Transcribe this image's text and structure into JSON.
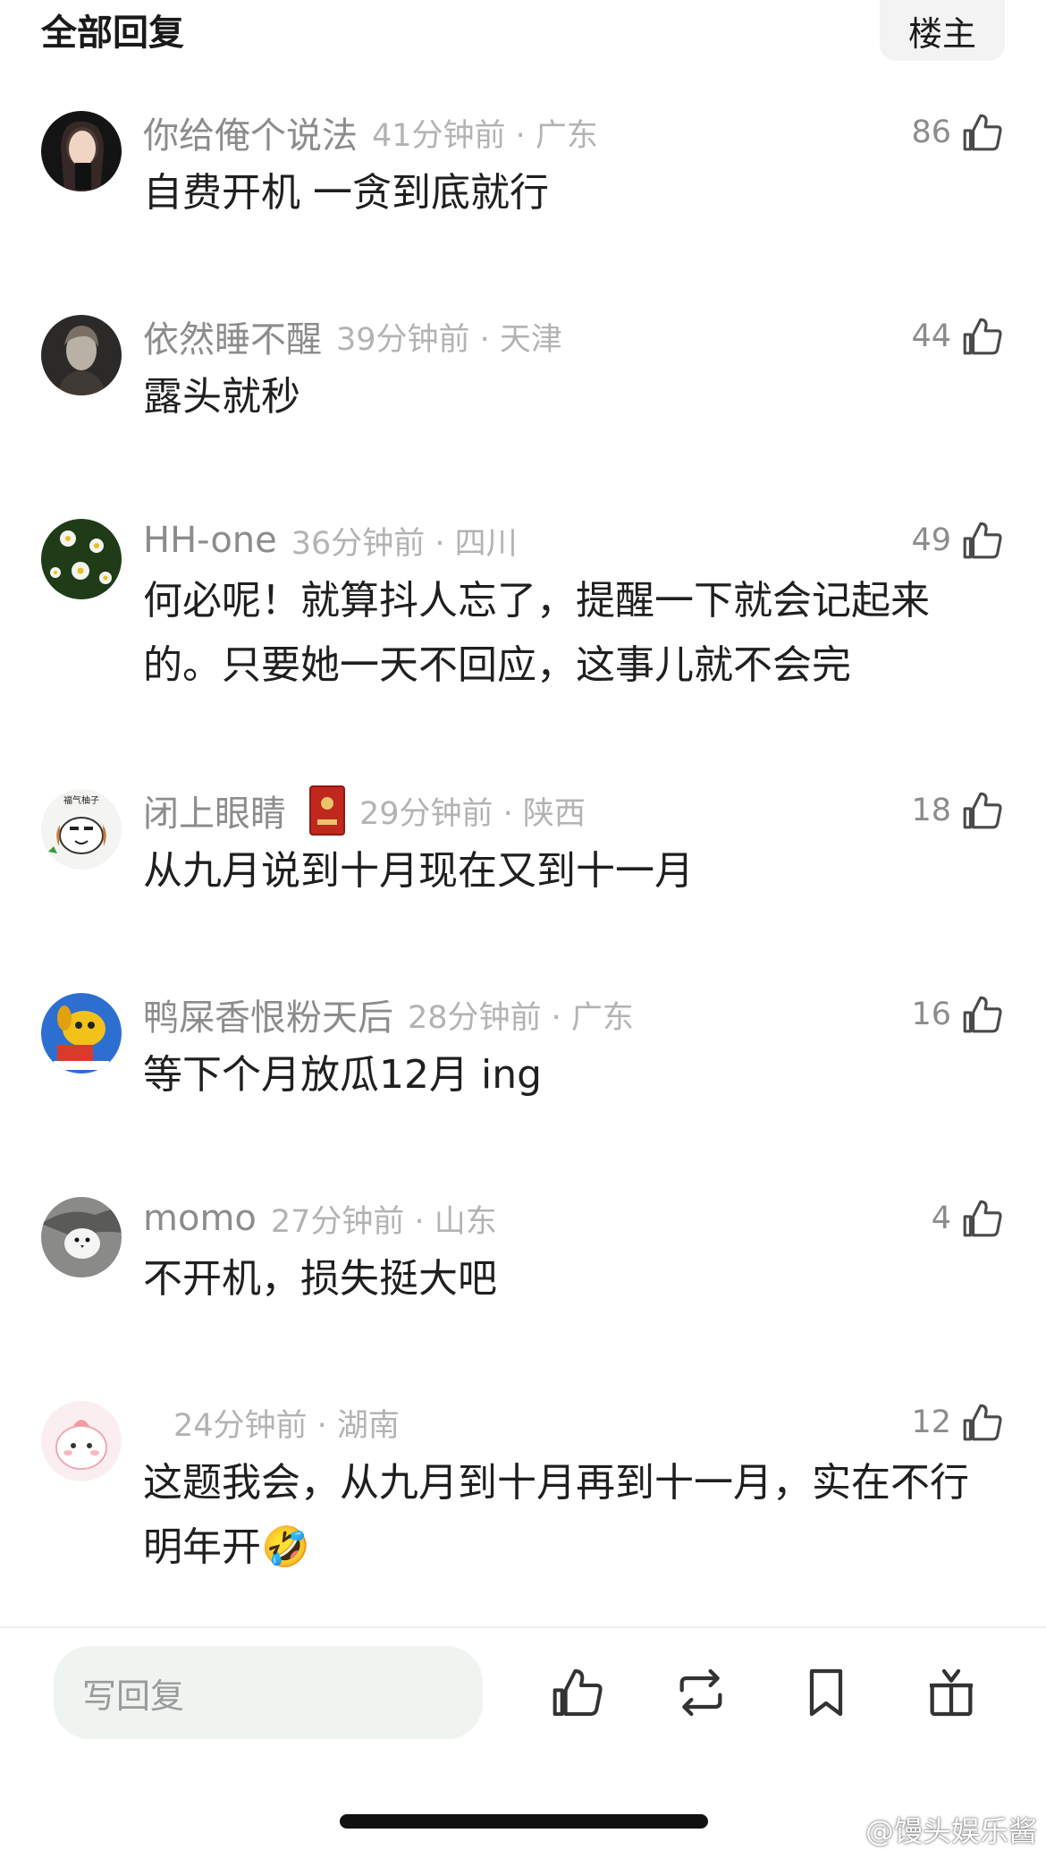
{
  "header": {
    "title": "全部回复",
    "op_label": "楼主"
  },
  "comments": [
    {
      "username": "你给俺个说法",
      "time": "41分钟前 · 广东",
      "likes": "86",
      "text": "自费开机 一贪到底就行",
      "avatar": "dark-portrait"
    },
    {
      "username": "依然睡不醒",
      "time": "39分钟前 · 天津",
      "likes": "44",
      "text": "露头就秒",
      "avatar": "gray-portrait"
    },
    {
      "username": "HH-one",
      "time": "36分钟前 · 四川",
      "likes": "49",
      "text": "何必呢！就算抖人忘了，提醒一下就会记起来的。只要她一天不回应，这事儿就不会完",
      "avatar": "daisy-flowers"
    },
    {
      "username": "闭上眼睛",
      "time": "29分钟前 · 陕西",
      "likes": "18",
      "text": "从九月说到十月现在又到十一月",
      "avatar": "cartoon-dog",
      "avatar_label": "福气柚子",
      "badge": "red-envelope-badge"
    },
    {
      "username": "鸭屎香恨粉天后",
      "time": "28分钟前 · 广东",
      "likes": "16",
      "text": "等下个月放瓜12月 ing",
      "avatar": "yellow-cartoon-dog"
    },
    {
      "username": "momo",
      "time": "27分钟前 · 山东",
      "likes": "4",
      "text": "不开机，损失挺大吧",
      "avatar": "white-bird"
    },
    {
      "username": "",
      "time": "24分钟前 · 湖南",
      "likes": "12",
      "text": "这题我会，从九月到十月再到十一月，实在不行明年开🤣",
      "avatar": "pink-blob"
    }
  ],
  "footer": {
    "reply_placeholder": "写回复",
    "actions": [
      "like-icon",
      "repost-icon",
      "bookmark-icon",
      "gift-icon"
    ]
  },
  "watermark": "@馒头娱乐酱",
  "colors": {
    "meta_gray": "#8c8c8c",
    "time_gray": "#b3b3b3",
    "input_bg": "#f0f4f1"
  }
}
